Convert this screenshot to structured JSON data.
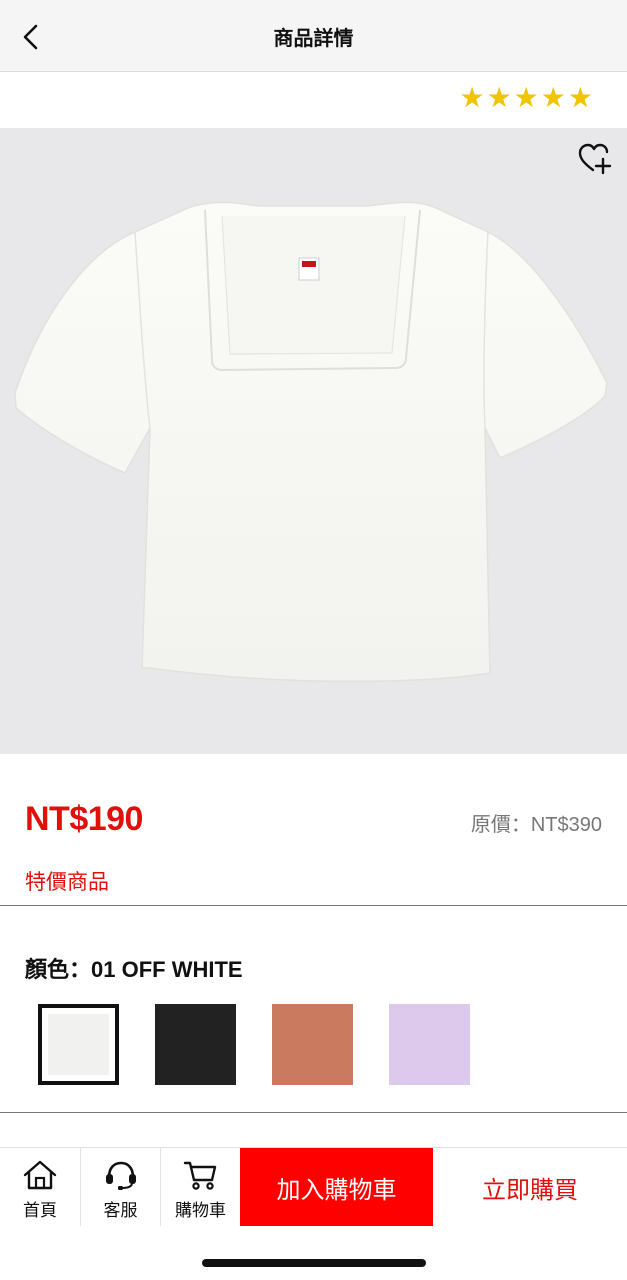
{
  "header": {
    "title": "商品詳情",
    "back_icon": "chevron-left-icon"
  },
  "rating": {
    "stars": 5,
    "star_glyph": "★",
    "color": "#f0c400"
  },
  "product": {
    "image_icon": "white-square-neck-tshirt-image",
    "wishlist_icon": "heart-plus-icon",
    "price": "NT$190",
    "original_price": "原價：NT$390",
    "promo_label": "特價商品",
    "price_color": "#e0100c"
  },
  "color_picker": {
    "label": "顏色：",
    "selected_value": "01 OFF WHITE",
    "swatches": [
      {
        "name": "off-white",
        "color": "#f1f1ef",
        "selected": true
      },
      {
        "name": "black",
        "color": "#222222",
        "selected": false
      },
      {
        "name": "terracotta",
        "color": "#c97a5f",
        "selected": false
      },
      {
        "name": "lavender",
        "color": "#ddc9ec",
        "selected": false
      }
    ]
  },
  "bottom_bar": {
    "home": {
      "label": "首頁",
      "icon": "home-icon"
    },
    "service": {
      "label": "客服",
      "icon": "headset-icon"
    },
    "cart": {
      "label": "購物車",
      "icon": "cart-icon"
    },
    "add_to_cart": "加入購物車",
    "buy_now": "立即購買",
    "accent": "#ff0000"
  }
}
